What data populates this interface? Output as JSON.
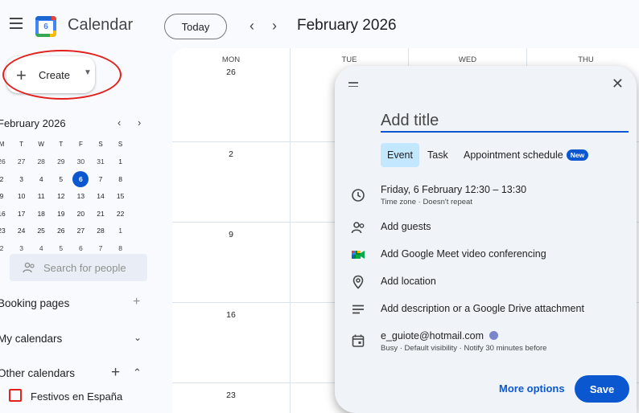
{
  "header": {
    "app_title": "Calendar",
    "logo_day": "6",
    "today_label": "Today",
    "prev_symbol": "‹",
    "next_symbol": "›",
    "month_title": "February 2026"
  },
  "sidebar": {
    "create_label": "Create",
    "mini_calendar": {
      "month_label": "February 2026",
      "days_of_week": [
        "M",
        "T",
        "W",
        "T",
        "F",
        "S",
        "S"
      ],
      "weeks": [
        [
          "26",
          "27",
          "28",
          "29",
          "30",
          "31",
          "1"
        ],
        [
          "2",
          "3",
          "4",
          "5",
          "6",
          "7",
          "8"
        ],
        [
          "9",
          "10",
          "11",
          "12",
          "13",
          "14",
          "15"
        ],
        [
          "16",
          "17",
          "18",
          "19",
          "20",
          "21",
          "22"
        ],
        [
          "23",
          "24",
          "25",
          "26",
          "27",
          "28",
          "1"
        ],
        [
          "2",
          "3",
          "4",
          "5",
          "6",
          "7",
          "8"
        ]
      ],
      "selected_day": "6"
    },
    "search_people_placeholder": "Search for people",
    "booking_pages_label": "Booking pages",
    "my_calendars_label": "My calendars",
    "other_calendars_label": "Other calendars",
    "other_calendars_items": [
      "Festivos en España"
    ]
  },
  "grid": {
    "days_of_week": [
      "MON",
      "TUE",
      "WED",
      "THU"
    ],
    "week_starts": [
      "26",
      "2",
      "9",
      "16",
      "23"
    ]
  },
  "dialog": {
    "title_placeholder": "Add title",
    "tabs": [
      "Event",
      "Task",
      "Appointment schedule"
    ],
    "new_badge": "New",
    "datetime": "Friday, 6 February   12:30  –  13:30",
    "datetime_sub": "Time zone · Doesn't repeat",
    "add_guests": "Add guests",
    "add_meet": "Add Google Meet video conferencing",
    "add_location": "Add location",
    "add_description": "Add description or a Google Drive attachment",
    "calendar_owner": "e_guiote@hotmail.com",
    "calendar_details": "Busy · Default visibility · Notify 30 minutes before",
    "more_options": "More options",
    "save": "Save"
  },
  "colors": {
    "accent": "#0b57d0",
    "highlight_tab": "#c2e7ff",
    "annotation_red": "#e2201c",
    "calendar_color": "#7986cb"
  }
}
